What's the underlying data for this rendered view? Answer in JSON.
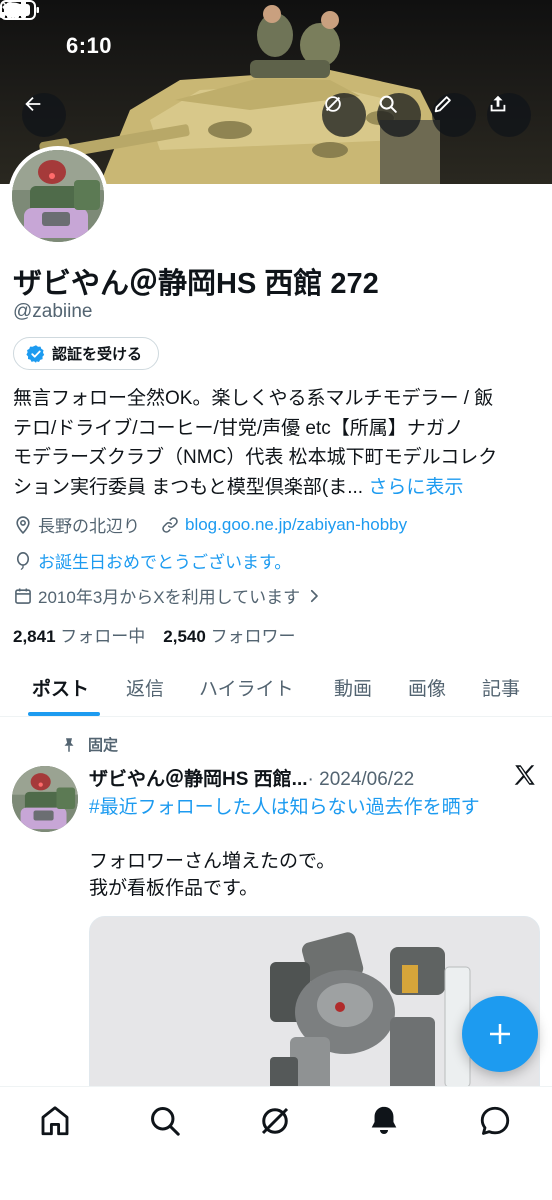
{
  "status_bar": {
    "time": "6:10"
  },
  "header": {
    "back_icon": "arrow-left-icon",
    "actions": [
      "grok-icon",
      "search-icon",
      "edit-icon",
      "share-icon"
    ]
  },
  "profile": {
    "display_name": "ザビやん＠静岡HS 西館 272",
    "handle": "@zabiine",
    "verify_label": "認証を受ける",
    "bio_lines": [
      "無言フォロー全然OK。楽しくやる系マルチモデラー / 飯",
      "テロ/ドライブ/コーヒー/甘党/声優 etc【所属】ナガノ",
      "モデラーズクラブ（NMC）代表 松本城下町モデルコレク",
      "ション実行委員 まつもと模型倶楽部(ま..."
    ],
    "bio_more": "さらに表示",
    "location": "長野の北辺り",
    "website": "blog.goo.ne.jp/zabiyan-hobby",
    "birthday": "お誕生日おめでとうございます。",
    "joined": "2010年3月からXを利用しています",
    "following_count": "2,841",
    "following_label": "フォロー中",
    "followers_count": "2,540",
    "followers_label": "フォロワー"
  },
  "tabs": [
    "ポスト",
    "返信",
    "ハイライト",
    "動画",
    "画像",
    "記事"
  ],
  "active_tab": "ポスト",
  "pinned_post": {
    "pinned_label": "固定",
    "author": "ザビやん＠静岡HS 西館...",
    "date": "· 2024/06/22",
    "hashtag": "#最近フォローした人は知らない過去作を晒す",
    "text_lines": [
      "フォロワーさん増えたので。",
      "我が看板作品です。"
    ]
  },
  "fab_icon": "plus-icon",
  "bottom_nav": [
    "home-icon",
    "search-icon",
    "grok-icon",
    "notifications-icon",
    "messages-icon"
  ],
  "colors": {
    "accent": "#1d9bf0",
    "text": "#0f1419",
    "secondary": "#536471",
    "border": "#cfd9de"
  }
}
